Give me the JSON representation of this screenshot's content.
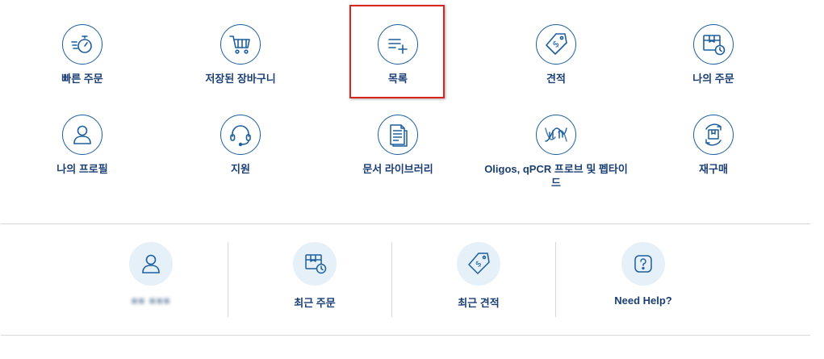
{
  "tiles": [
    {
      "label": "빠른 주문",
      "icon": "quick-order-icon"
    },
    {
      "label": "저장된 장바구니",
      "icon": "cart-icon"
    },
    {
      "label": "목록",
      "icon": "list-add-icon"
    },
    {
      "label": "견적",
      "icon": "quote-tag-icon"
    },
    {
      "label": "나의 주문",
      "icon": "box-clock-icon"
    },
    {
      "label": "나의 프로필",
      "icon": "user-icon"
    },
    {
      "label": "지원",
      "icon": "headset-icon"
    },
    {
      "label": "문서 라이브러리",
      "icon": "document-library-icon"
    },
    {
      "label": "Oligos, qPCR 프로브 및 펩타이드",
      "icon": "dna-icon"
    },
    {
      "label": "재구매",
      "icon": "reorder-box-icon"
    }
  ],
  "bottom": {
    "profile_name": "■■ ■■■",
    "recent_orders": "최근 주문",
    "recent_quotes": "최근 견적",
    "need_help": "Need Help?"
  },
  "colors": {
    "primary": "#1d5f9e",
    "text": "#1b3f73",
    "highlight": "#d7261e",
    "soft_bg": "#e6f0f8"
  }
}
